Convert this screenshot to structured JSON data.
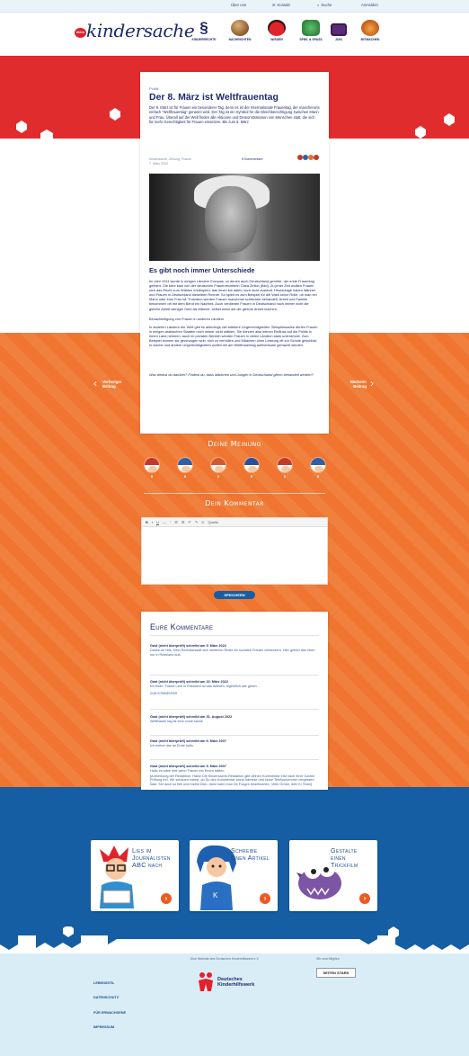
{
  "topbar": {
    "links": [
      "Über uns",
      "Kontakt",
      "Suche",
      "Anmelden"
    ]
  },
  "header": {
    "logo_prefix": "dkhw",
    "logo_text": "kindersache",
    "nav": [
      {
        "label": "Kinderrechte",
        "icon": "paragraph-icon",
        "color": "#1d2a6a"
      },
      {
        "label": "Nachrichten",
        "icon": "globe-icon",
        "color": "#8b5a2b"
      },
      {
        "label": "Wissen",
        "icon": "ladybug-icon",
        "color": "#c0262b"
      },
      {
        "label": "Spiel & Spaß",
        "icon": "gamepad-icon",
        "color": "#2e8b3d"
      },
      {
        "label": "Juki",
        "icon": "tv-icon",
        "color": "#6a2b8a"
      },
      {
        "label": "Mitmachen",
        "icon": "cat-icon",
        "color": "#e0742b"
      }
    ]
  },
  "article": {
    "kicker": "Politik",
    "title": "Der 8. März ist Weltfrauentag",
    "intro": "Der 8. März ist für Frauen ein besonderer Tag, denn es ist der Internationale Frauentag, der mancherorts einfach \"Weltfrauentag\" genannt wird. Der Tag ist ein Symbol für die Gleichberechtigung zwischen Mann und Frau. Überall auf der Welt finden alle Aktionen und Demonstrationen von Menschen statt, die sich für mehr Gerechtigkeit für Frauen einsetzen. Bis zum 8. März",
    "author": "Kindersache, Zeitung, Frauen",
    "date": "7. März 2022",
    "comment_count": "5 Kommentare",
    "h2": "Es gibt noch immer Unterschiede",
    "p1": "Im Jahr 1911 wurde in einigen Ländern Europas, zu denen auch Deutschland gehörte, der erste Frauentag gefeiert. Die Idee kam von der deutschen Frauenrechtlerin Clara Zetkin (Bild). Zu jener Zeit wollten Frauen sich das Recht zum Wählen erkämpfen, das ihnen bis dahin noch nicht zustand. Heutzutage haben Männer und Frauen in Deutschland dieselben Rechte. So spielt es zum Beispiel für die Wahl keine Rolle, ob man ein Mann oder eine Frau ist. Trotzdem werden Frauen manchmal schlechter behandelt. Arbeit und Familie bekommen oft mit dem Beruf ein Nachteil. Auch verdienen Frauen in Deutschland noch immer nicht die gleiche Arbeit weniger Geld als Männer, selbst wenn sie die gleiche Arbeit machen.",
    "subhead": "Benachteiligung von Frauen in anderen Ländern",
    "p2": "In anderen Ländern der Welt gibt es allerdings viel stärkere Ungerechtigkeiten. Beispielsweise dürfen Frauen in einigen arabischen Staaten noch immer nicht wählen. Sie können also keinen Einfluss auf die Politik in ihrem Land nehmen, auch im privaten Bereich werden Frauen in vielen Ländern stark unterdrückt. Zum Beispiel können sie gezwungen sein, sich zu verhüllen und Mädchen ohne Leistung oft zur Schule geschickt. In solche und andere Ungerechtigkeiten wollen wir am Weltfrauentag aufmerksam gemacht werden.",
    "question": "Was denkst du darüber? Findest du, dass Mädchen und Jungen in Deutschland gleich behandelt werden?"
  },
  "prev_label": "Vorheriger Beitrag",
  "next_label": "Nächster Beitrag",
  "opinion": {
    "title": "Deine Meinung",
    "faces": [
      {
        "count": "0",
        "hair": "#c0392b"
      },
      {
        "count": "0",
        "hair": "#2f5fa8"
      },
      {
        "count": "0",
        "hair": "#d15a2b"
      },
      {
        "count": "0",
        "hair": "#2a4f9c"
      },
      {
        "count": "0",
        "hair": "#c0392b"
      },
      {
        "count": "0",
        "hair": "#2f5fa8"
      }
    ]
  },
  "comment_form": {
    "title": "Dein Kommentar",
    "toolbar": [
      "B",
      "I",
      "U",
      "—",
      "“",
      "☰",
      "☰",
      "↶",
      "↷",
      "⊙",
      "Quelle"
    ],
    "send_label": "SPEICHERN"
  },
  "comments": {
    "title": "Eure Kommentare",
    "items": [
      {
        "who": "Gast (nicht überprüft) schreibt am 5. März 2022",
        "text": "Danke an Nils, Dein Rechtsanwalt sich weiterhin Reste für sozialen Frauen verbessern. Hier gehört das eben nur in Russland aus.",
        "link": ""
      },
      {
        "who": "Gast (nicht überprüft) schreibt am 22. März 2022",
        "text": "Ich finde, Frauen und in Russland ist das Wählen, eigentlich wie gleich...",
        "link": "ZUM KOMMENTAR"
      },
      {
        "who": "Gast (nicht überprüft) schreibt am 31. August 2022",
        "text": "Weltfrauen tag ist eine coole sache",
        "link": ""
      },
      {
        "who": "Gast (nicht überprüft) schreibt am 9. März 2007",
        "text": "Ich meine das an Ende hallo",
        "link": ""
      },
      {
        "who": "Gast (nicht überprüft) schreibt am 5. März 2007",
        "text": "Hallo es wäre nett wenn Frauen ein Recht hätten",
        "link": "[Anmerkung der Redaktion: Hallo! Die Kindersache-Redaktion gibt deinen Kommentar erst nach einer kurzen Prüfung frei. Wir schauen zuerst, ob Du den Kommentar keine Adresse und keine Telefonnummer vergessen hast. Sei doch so lieb und melde Dich, dann kann man Dir Fragen beantworten. Viele Grüße, dein Ki Team]"
      }
    ]
  },
  "promos": [
    {
      "title": "Lies im Journalisten ABC nach",
      "icon": "reader-boy-icon"
    },
    {
      "title": "Schreibe einen Artikel",
      "icon": "writer-girl-icon"
    },
    {
      "title": "Gestalte einen Trickfilm",
      "icon": "fish-monster-icon"
    }
  ],
  "footer": {
    "links": [
      "LEBENSSTIL",
      "DATENSCHUTZ",
      "FÜR ERWACHSENE",
      "IMPRESSUM"
    ],
    "partner_caption": "Eine Website des Deutschen Kinderhilfswerk e.V.",
    "partner_name": "Deutsches Kinderhilfswerk",
    "seal_caption": "Wir sind Mitglied",
    "seal_text": "SEITEN STARK"
  },
  "colors": {
    "red": "#e12c2e",
    "orange": "#ef7531",
    "blue": "#155ea4",
    "navy": "#1d2a6a",
    "footer_bg": "#d8edf6"
  }
}
